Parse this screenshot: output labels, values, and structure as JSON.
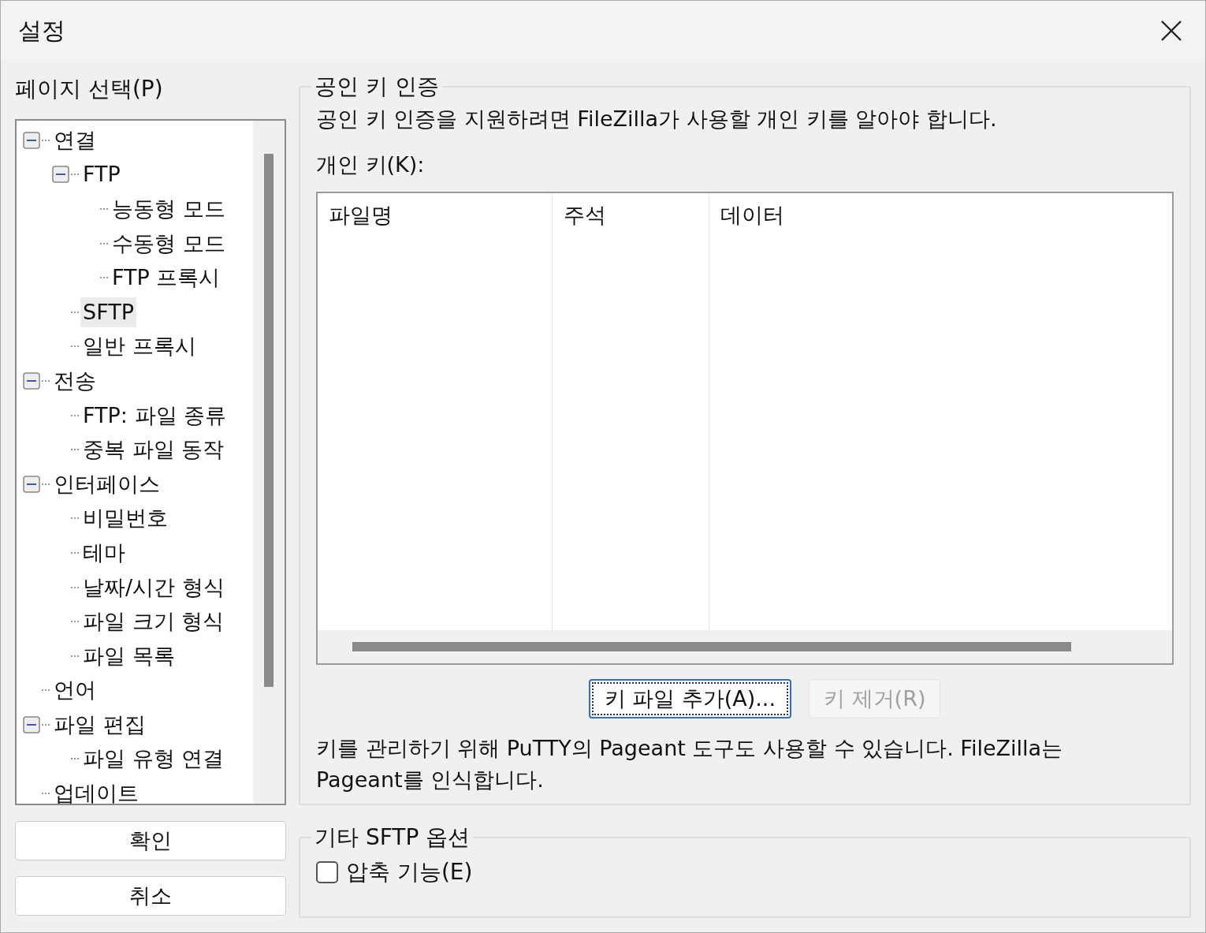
{
  "window": {
    "title": "설정"
  },
  "sidebar": {
    "label": "페이지 선택(P)",
    "tree": [
      {
        "label": "연결",
        "expanded": true,
        "selected": false,
        "children": [
          {
            "label": "FTP",
            "expanded": true,
            "selected": false,
            "children": [
              {
                "label": "능동형 모드",
                "selected": false
              },
              {
                "label": "수동형 모드",
                "selected": false
              },
              {
                "label": "FTP 프록시",
                "selected": false
              }
            ]
          },
          {
            "label": "SFTP",
            "selected": true
          },
          {
            "label": "일반 프록시",
            "selected": false
          }
        ]
      },
      {
        "label": "전송",
        "expanded": true,
        "selected": false,
        "children": [
          {
            "label": "FTP: 파일 종류",
            "selected": false
          },
          {
            "label": "중복 파일 동작",
            "selected": false
          }
        ]
      },
      {
        "label": "인터페이스",
        "expanded": true,
        "selected": false,
        "children": [
          {
            "label": "비밀번호",
            "selected": false
          },
          {
            "label": "테마",
            "selected": false
          },
          {
            "label": "날짜/시간 형식",
            "selected": false
          },
          {
            "label": "파일 크기 형식",
            "selected": false
          },
          {
            "label": "파일 목록",
            "selected": false
          }
        ]
      },
      {
        "label": "언어",
        "selected": false
      },
      {
        "label": "파일 편집",
        "expanded": true,
        "selected": false,
        "children": [
          {
            "label": "파일 유형 연결",
            "selected": false
          }
        ]
      },
      {
        "label": "업데이트",
        "selected": false
      }
    ],
    "buttons": [
      {
        "label": "확인"
      },
      {
        "label": "취소"
      }
    ]
  },
  "public_key_auth": {
    "title": "공인 키 인증",
    "description": "공인 키 인증을 지원하려면 FileZilla가 사용할 개인 키를 알아야 합니다.",
    "keys_label": "개인 키(K):",
    "table": {
      "columns": [
        "파일명",
        "주석",
        "데이터"
      ]
    },
    "buttons": [
      {
        "label": "키 파일 추가(A)...",
        "disabled": false,
        "focused": true
      },
      {
        "label": "키 제거(R)",
        "disabled": true,
        "focused": false
      }
    ],
    "note": "키를 관리하기 위해 PuTTY의 Pageant 도구도 사용할 수 있습니다. FileZilla는 Pageant를 인식합니다."
  },
  "other_options": {
    "title": "기타 SFTP 옵션",
    "checkboxes": [
      {
        "label": "압축 기능(E)",
        "checked": false
      }
    ]
  }
}
